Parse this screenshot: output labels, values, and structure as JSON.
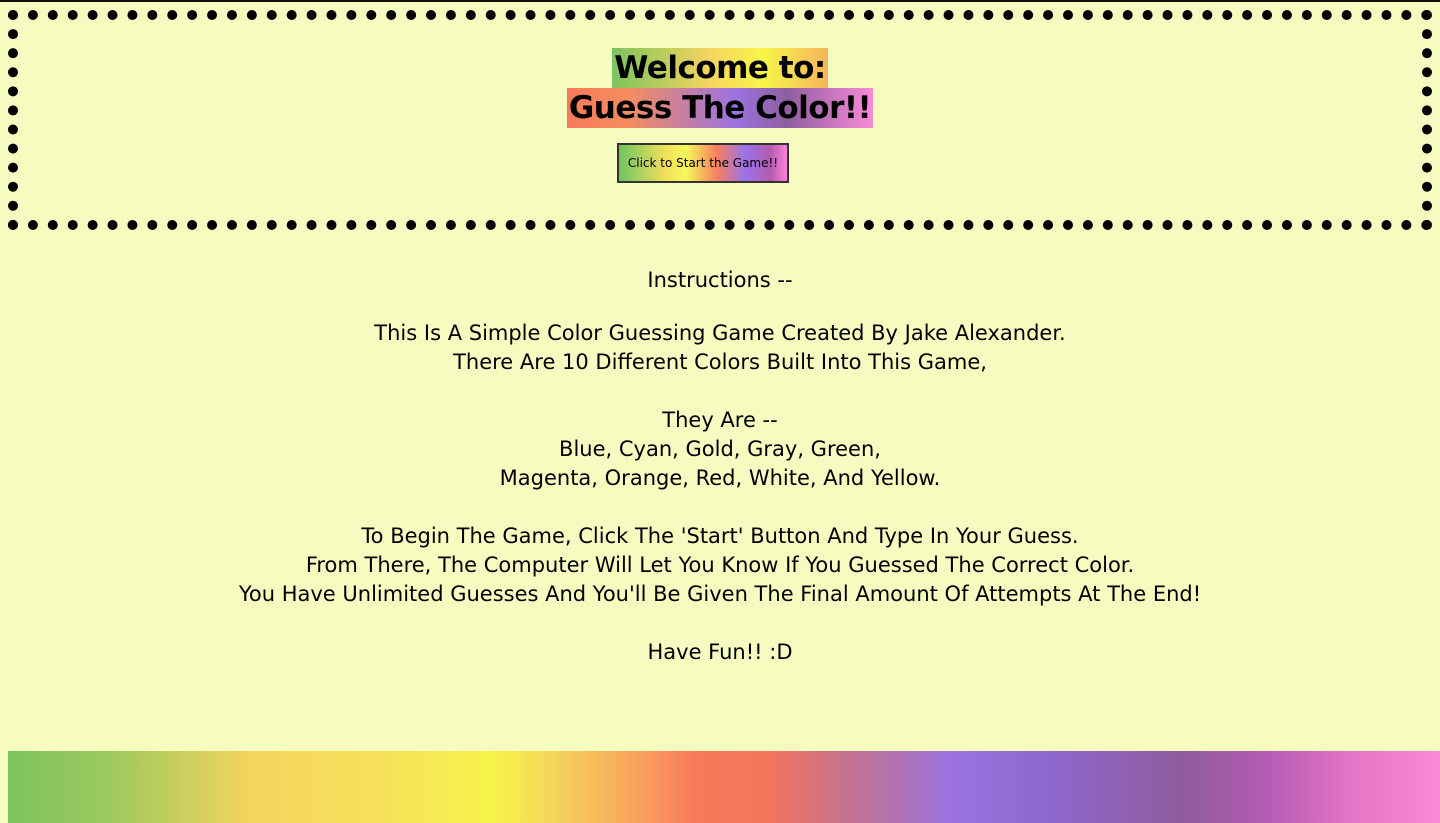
{
  "header": {
    "welcome": "Welcome to:",
    "title": "Guess The Color!!",
    "start_button_label": "Click to Start the Game!!"
  },
  "instructions": {
    "heading": "Instructions --",
    "intro_line_1": "This Is A Simple Color Guessing Game Created By Jake Alexander.",
    "intro_line_2": "There Are 10 Different Colors Built Into This Game,",
    "colors_heading": "They Are --",
    "colors_line_1": "Blue, Cyan, Gold, Gray, Green,",
    "colors_line_2": "Magenta, Orange, Red, White, And Yellow.",
    "howto_line_1": "To Begin The Game, Click The 'Start' Button And Type In Your Guess.",
    "howto_line_2": "From There, The Computer Will Let You Know If You Guessed The Correct Color.",
    "howto_line_3": "You Have Unlimited Guesses And You'll Be Given The Final Amount Of Attempts At The End!",
    "closing": "Have Fun!! :D"
  },
  "colors": {
    "background": "#f6fbc0",
    "border": "#000000",
    "rainbow": [
      "#7cc45e",
      "#f5d45e",
      "#f7f34a",
      "#f87a5a",
      "#9a73e0",
      "#8e5c9c",
      "#f98ad8"
    ]
  }
}
